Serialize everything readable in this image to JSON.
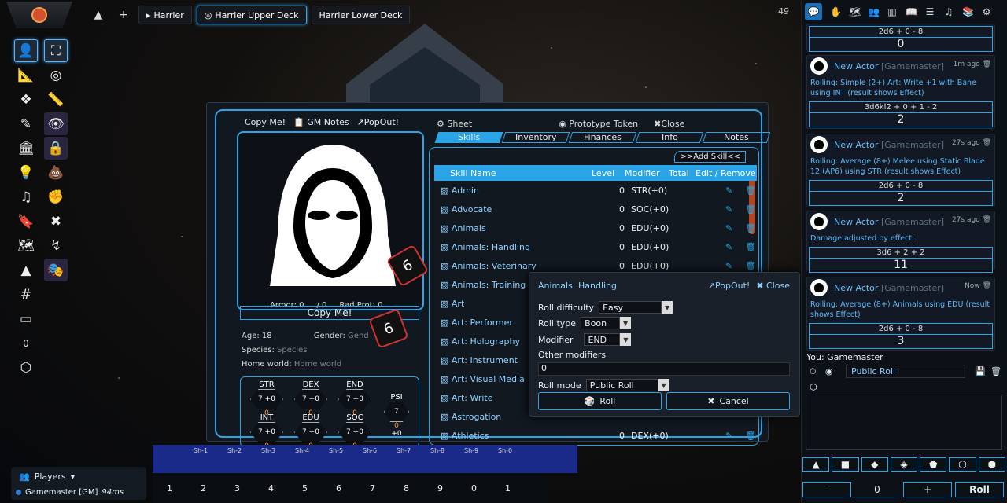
{
  "nav": {
    "scene_up": "▲",
    "add": "+",
    "scenes": [
      "Harrier",
      "Harrier Upper Deck",
      "Harrier Lower Deck"
    ],
    "fps": "49"
  },
  "left_counter": "0",
  "sheet": {
    "header": {
      "copy": "Copy Me!",
      "gm_notes": "GM Notes",
      "popout": "PopOut!",
      "sheet": "Sheet",
      "proto": "Prototype Token",
      "close": "Close"
    },
    "tabs": [
      "Skills",
      "Inventory",
      "Finances",
      "Info",
      "Notes"
    ],
    "armor_label": "Armor: 0",
    "armor_max": "/ 0",
    "rad_label": "Rad Prot: 0",
    "name": "Copy Me!",
    "age": "Age: 18",
    "gender_label": "Gender:",
    "gender_ph": "Gend",
    "species_label": "Species:",
    "species_ph": "Species",
    "home_label": "Home world:",
    "home_ph": "Home world",
    "chars": [
      {
        "k": "STR",
        "v": "7",
        "m": "+0",
        "d": "0"
      },
      {
        "k": "DEX",
        "v": "7",
        "m": "+0",
        "d": "0"
      },
      {
        "k": "END",
        "v": "7",
        "m": "+0",
        "d": "0"
      },
      {
        "k": "INT",
        "v": "7",
        "m": "+0",
        "d": "0"
      },
      {
        "k": "EDU",
        "v": "7",
        "m": "+0",
        "d": "0"
      },
      {
        "k": "SOC",
        "v": "7",
        "m": "+0",
        "d": "0"
      }
    ],
    "psi": {
      "k": "PSI",
      "v": "7",
      "d": "0",
      "m": "+0"
    },
    "add_skill": ">>Add Skill<<",
    "skill_head": [
      "Skill Name",
      "Level",
      "Modifier",
      "Total",
      "Edit / Remove"
    ],
    "skills": [
      {
        "name": "Admin",
        "level": "0",
        "mod": "STR(+0)"
      },
      {
        "name": "Advocate",
        "level": "0",
        "mod": "SOC(+0)"
      },
      {
        "name": "Animals",
        "level": "0",
        "mod": "EDU(+0)"
      },
      {
        "name": "Animals: Handling",
        "level": "0",
        "mod": "EDU(+0)"
      },
      {
        "name": "Animals: Veterinary",
        "level": "0",
        "mod": "EDU(+0)"
      },
      {
        "name": "Animals: Training",
        "level": "",
        "mod": ""
      },
      {
        "name": "Art",
        "level": "",
        "mod": ""
      },
      {
        "name": "Art: Performer",
        "level": "",
        "mod": ""
      },
      {
        "name": "Art: Holography",
        "level": "",
        "mod": ""
      },
      {
        "name": "Art: Instrument",
        "level": "",
        "mod": ""
      },
      {
        "name": "Art: Visual Media",
        "level": "",
        "mod": ""
      },
      {
        "name": "Art: Write",
        "level": "",
        "mod": ""
      },
      {
        "name": "Astrogation",
        "level": "",
        "mod": ""
      },
      {
        "name": "Athletics",
        "level": "0",
        "mod": "DEX(+0)"
      }
    ]
  },
  "roll_dialog": {
    "title": "Animals: Handling",
    "popout": "PopOut!",
    "close": "Close",
    "difficulty_label": "Roll difficulty",
    "difficulty": "Easy",
    "type_label": "Roll type",
    "type": "Boon",
    "modifier_label": "Modifier",
    "modifier": "END",
    "other_label": "Other modifiers",
    "other": "0",
    "mode_label": "Roll mode",
    "mode": "Public Roll",
    "roll": "Roll",
    "cancel": "Cancel"
  },
  "chat": {
    "top_formula": "2d6 + 0 - 8",
    "top_total": "0",
    "messages": [
      {
        "who": "New Actor",
        "gm": "[Gamemaster]",
        "time": "1m ago",
        "text": "Rolling: Simple (2+) Art: Write +1 with Bane using INT (result shows Effect)",
        "formula": "3d6kl2 + 0 + 1 - 2",
        "total": "2"
      },
      {
        "who": "New Actor",
        "gm": "[Gamemaster]",
        "time": "27s ago",
        "text": "Rolling: Average (8+) Melee using Static Blade 12 (AP6) using STR (result shows Effect)",
        "formula": "2d6 + 0 - 8",
        "total": "2"
      },
      {
        "who": "New Actor",
        "gm": "[Gamemaster]",
        "time": "27s ago",
        "text": "Damage adjusted by effect:",
        "formula": "3d6 + 2 + 2",
        "total": "11"
      },
      {
        "who": "New Actor",
        "gm": "[Gamemaster]",
        "time": "Now",
        "text": "Rolling: Average (8+) Animals using EDU (result shows Effect)",
        "formula": "2d6 + 0 - 8",
        "total": "3"
      }
    ],
    "you": "You: Gamemaster",
    "rollmode": "Public Roll",
    "minus": "-",
    "value": "0",
    "plus": "+",
    "roll": "Roll"
  },
  "players": {
    "title": "Players",
    "user": "Gamemaster [GM]",
    "ping": "94ms"
  },
  "hotbar": {
    "labels": [
      "Sh-1",
      "Sh-2",
      "Sh-3",
      "Sh-4",
      "Sh-5",
      "Sh-6",
      "Sh-7",
      "Sh-8",
      "Sh-9",
      "Sh-0"
    ],
    "slots": [
      "1",
      "2",
      "3",
      "4",
      "5",
      "6",
      "7",
      "8",
      "9",
      "0"
    ],
    "page": "1"
  },
  "dice_faces": [
    "6",
    "6"
  ]
}
